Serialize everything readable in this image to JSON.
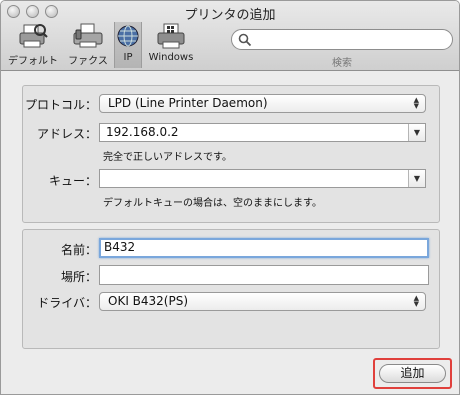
{
  "window": {
    "title": "プリンタの追加"
  },
  "toolbar": {
    "items": [
      {
        "label": "デフォルト",
        "icon": "default-printer-icon"
      },
      {
        "label": "ファクス",
        "icon": "fax-icon"
      },
      {
        "label": "IP",
        "icon": "ip-globe-icon",
        "selected": true
      },
      {
        "label": "Windows",
        "icon": "windows-printer-icon"
      }
    ],
    "search": {
      "placeholder": "",
      "label": "検索"
    }
  },
  "connection": {
    "protocol_label": "プロトコル：",
    "protocol_value": "LPD (Line Printer Daemon)",
    "address_label": "アドレス：",
    "address_value": "192.168.0.2",
    "address_hint": "完全で正しいアドレスです。",
    "queue_label": "キュー：",
    "queue_value": "",
    "queue_hint": "デフォルトキューの場合は、空のままにします。"
  },
  "printer": {
    "name_label": "名前：",
    "name_value": "B432",
    "location_label": "場所：",
    "location_value": "",
    "driver_label": "ドライバ：",
    "driver_value": "OKI B432(PS)"
  },
  "actions": {
    "add_label": "追加"
  },
  "colors": {
    "highlight": "#e0403c",
    "focus": "#7aa7dc"
  }
}
